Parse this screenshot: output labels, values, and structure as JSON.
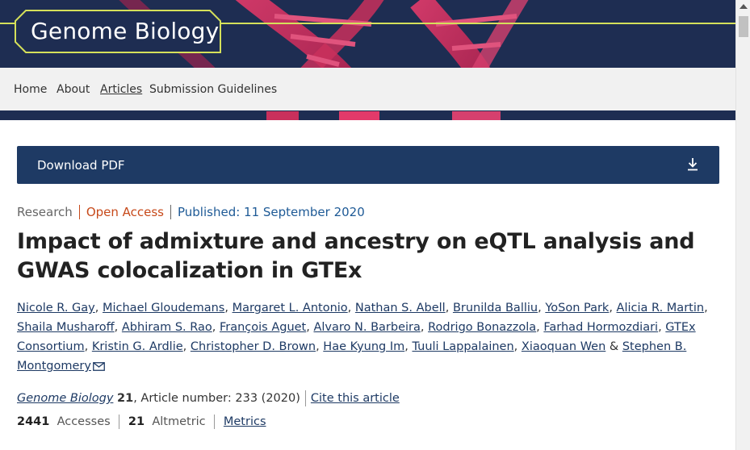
{
  "journal": {
    "name": "Genome Biology"
  },
  "nav": {
    "items": [
      {
        "label": "Home"
      },
      {
        "label": "About"
      },
      {
        "label": "Articles"
      },
      {
        "label": "Submission Guidelines"
      }
    ]
  },
  "download": {
    "label": "Download PDF",
    "icon": "download-icon"
  },
  "meta": {
    "type": "Research",
    "access": "Open Access",
    "published": "Published: 11 September 2020"
  },
  "title": "Impact of admixture and ancestry on eQTL analysis and GWAS colocalization in GTEx",
  "authors": [
    "Nicole R. Gay",
    "Michael Gloudemans",
    "Margaret L. Antonio",
    "Nathan S. Abell",
    "Brunilda Balliu",
    "YoSon Park",
    "Alicia R. Martin",
    "Shaila Musharoff",
    "Abhiram S. Rao",
    "François Aguet",
    "Alvaro N. Barbeira",
    "Rodrigo Bonazzola",
    "Farhad Hormozdiari",
    "GTEx Consortium",
    "Kristin G. Ardlie",
    "Christopher D. Brown",
    "Hae Kyung Im",
    "Tuuli Lappalainen",
    "Xiaoquan Wen",
    "Stephen B. Montgomery"
  ],
  "authors_separator": "&",
  "citation": {
    "journal": "Genome Biology",
    "volume": "21",
    "article_number": ", Article number: 233 (2020)",
    "cite_link": "Cite this article"
  },
  "metrics": {
    "accesses_value": "2441",
    "accesses_label": "Accesses",
    "altmetric_value": "21",
    "altmetric_label": "Altmetric",
    "metrics_link": "Metrics"
  },
  "colors": {
    "navy": "#1e2d52",
    "button": "#1e3a64",
    "open_access": "#c74a1b",
    "published": "#1e5a96",
    "logo_accent": "#d5e05a"
  }
}
